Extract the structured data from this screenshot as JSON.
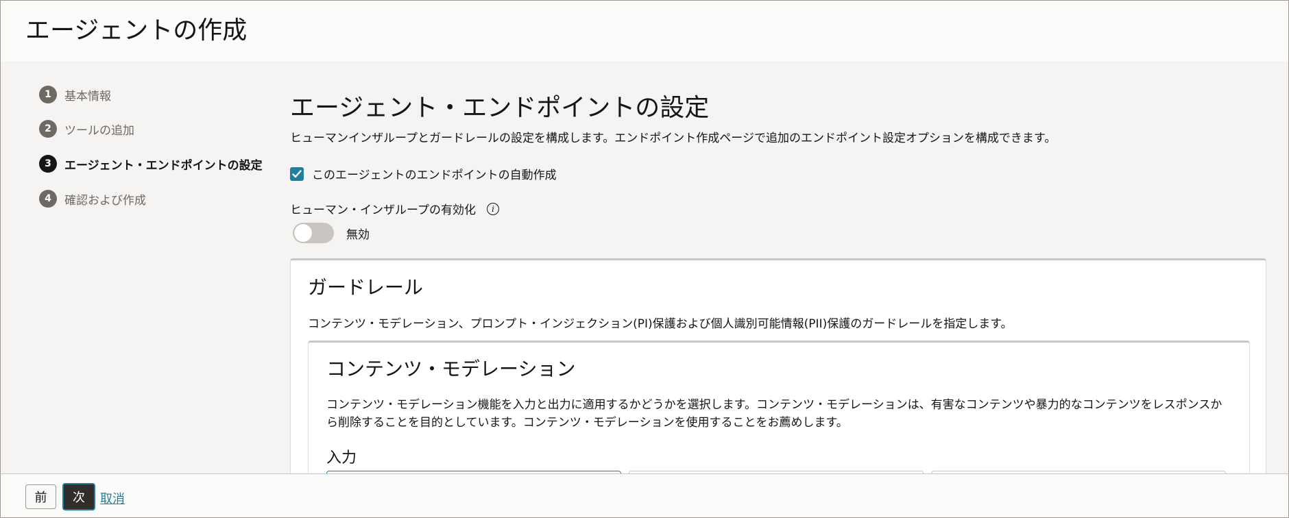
{
  "page": {
    "title": "エージェントの作成"
  },
  "steps": [
    {
      "num": "1",
      "label": "基本情報"
    },
    {
      "num": "2",
      "label": "ツールの追加"
    },
    {
      "num": "3",
      "label": "エージェント・エンドポイントの設定"
    },
    {
      "num": "4",
      "label": "確認および作成"
    }
  ],
  "active_step": 3,
  "section": {
    "title": "エージェント・エンドポイントの設定",
    "description": "ヒューマンインザループとガードレールの設定を構成します。エンドポイント作成ページで追加のエンドポイント設定オプションを構成できます。",
    "auto_create_checkbox": {
      "label": "このエージェントのエンドポイントの自動作成",
      "checked": true
    },
    "human_in_loop": {
      "label": "ヒューマン・インザループの有効化",
      "info_icon": "info-icon",
      "toggle_state": "無効",
      "enabled": false
    }
  },
  "guardrails": {
    "title": "ガードレール",
    "description": "コンテンツ・モデレーション、プロンプト・インジェクション(PI)保護および個人識別可能情報(PII)保護のガードレールを指定します。",
    "content_moderation": {
      "title": "コンテンツ・モデレーション",
      "description": "コンテンツ・モデレーション機能を入力と出力に適用するかどうかを選択します。コンテンツ・モデレーションは、有害なコンテンツや暴力的なコンテンツをレスポンスから削除することを目的としています。コンテンツ・モデレーションを使用することをお薦めします。",
      "input_label": "入力"
    }
  },
  "footer": {
    "prev": "前",
    "next": "次",
    "cancel": "取消"
  },
  "colors": {
    "accent": "#227e9e",
    "step_active": "#161513",
    "step_inactive": "#6f6964",
    "primary_button": "#312d2a"
  }
}
